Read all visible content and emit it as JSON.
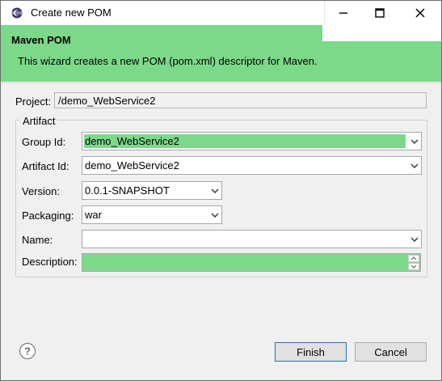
{
  "window": {
    "title": "Create new POM"
  },
  "banner": {
    "title": "Maven POM",
    "description": "This wizard creates a new POM (pom.xml) descriptor for Maven."
  },
  "project": {
    "label": "Project:",
    "value": "/demo_WebService2"
  },
  "artifact": {
    "group_title": "Artifact",
    "group_id": {
      "label": "Group Id:",
      "value": "demo_WebService2"
    },
    "artifact_id": {
      "label": "Artifact Id:",
      "value": "demo_WebService2"
    },
    "version": {
      "label": "Version:",
      "value": "0.0.1-SNAPSHOT"
    },
    "packaging": {
      "label": "Packaging:",
      "value": "war"
    },
    "name": {
      "label": "Name:",
      "value": ""
    },
    "description": {
      "label": "Description:",
      "value": ""
    }
  },
  "buttons": {
    "finish": "Finish",
    "cancel": "Cancel"
  },
  "colors": {
    "accent": "#7cd98a",
    "default_border": "#2d6fb9"
  },
  "icons": {
    "app": "eclipse-icon",
    "help": "help-icon"
  }
}
